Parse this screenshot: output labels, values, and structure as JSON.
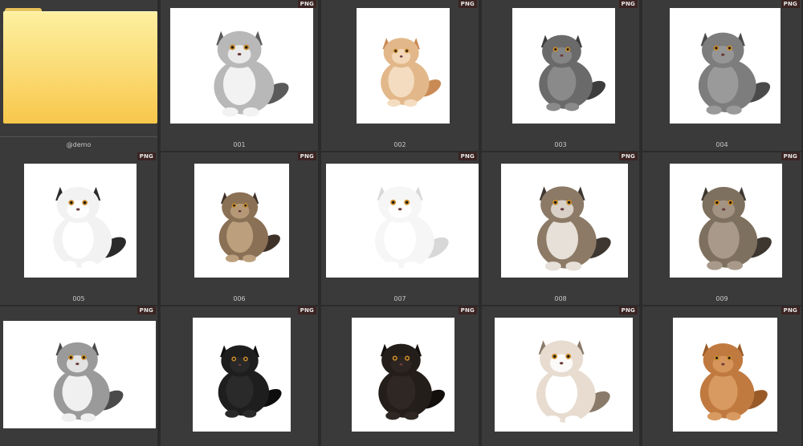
{
  "badge_label": "PNG",
  "folder": {
    "caption": "@demo",
    "icon": "folder-icon"
  },
  "items": [
    {
      "caption": "001",
      "fur": "#b8b8b8",
      "accent": "#5a5a5a",
      "belly": "#f2f2f2"
    },
    {
      "caption": "002",
      "fur": "#e2b88a",
      "accent": "#c98a55",
      "belly": "#f4dcc0"
    },
    {
      "caption": "003",
      "fur": "#6a6a6a",
      "accent": "#3c3c3c",
      "belly": "#8a8a8a"
    },
    {
      "caption": "004",
      "fur": "#7d7d7d",
      "accent": "#4a4a4a",
      "belly": "#9a9a9a"
    },
    {
      "caption": "005",
      "fur": "#f2f2f2",
      "accent": "#2a2a2a",
      "belly": "#ffffff"
    },
    {
      "caption": "006",
      "fur": "#8a7055",
      "accent": "#3e3128",
      "belly": "#bca07e"
    },
    {
      "caption": "007",
      "fur": "#f6f6f6",
      "accent": "#d8d8d8",
      "belly": "#ffffff"
    },
    {
      "caption": "008",
      "fur": "#8c7a66",
      "accent": "#3e3630",
      "belly": "#e6e0d8"
    },
    {
      "caption": "009",
      "fur": "#7e705e",
      "accent": "#3d3730",
      "belly": "#a8998a"
    },
    {
      "caption": "",
      "fur": "#9a9a9a",
      "accent": "#4a4a4a",
      "belly": "#f0f0f0"
    },
    {
      "caption": "",
      "fur": "#1e1e1e",
      "accent": "#0e0e0e",
      "belly": "#2a2a2a"
    },
    {
      "caption": "",
      "fur": "#241e1a",
      "accent": "#120f0d",
      "belly": "#2f2723"
    },
    {
      "caption": "",
      "fur": "#e8dcd0",
      "accent": "#8a7a6a",
      "belly": "#ffffff"
    },
    {
      "caption": "",
      "fur": "#c07a40",
      "accent": "#9a5a28",
      "belly": "#d89a60"
    }
  ]
}
